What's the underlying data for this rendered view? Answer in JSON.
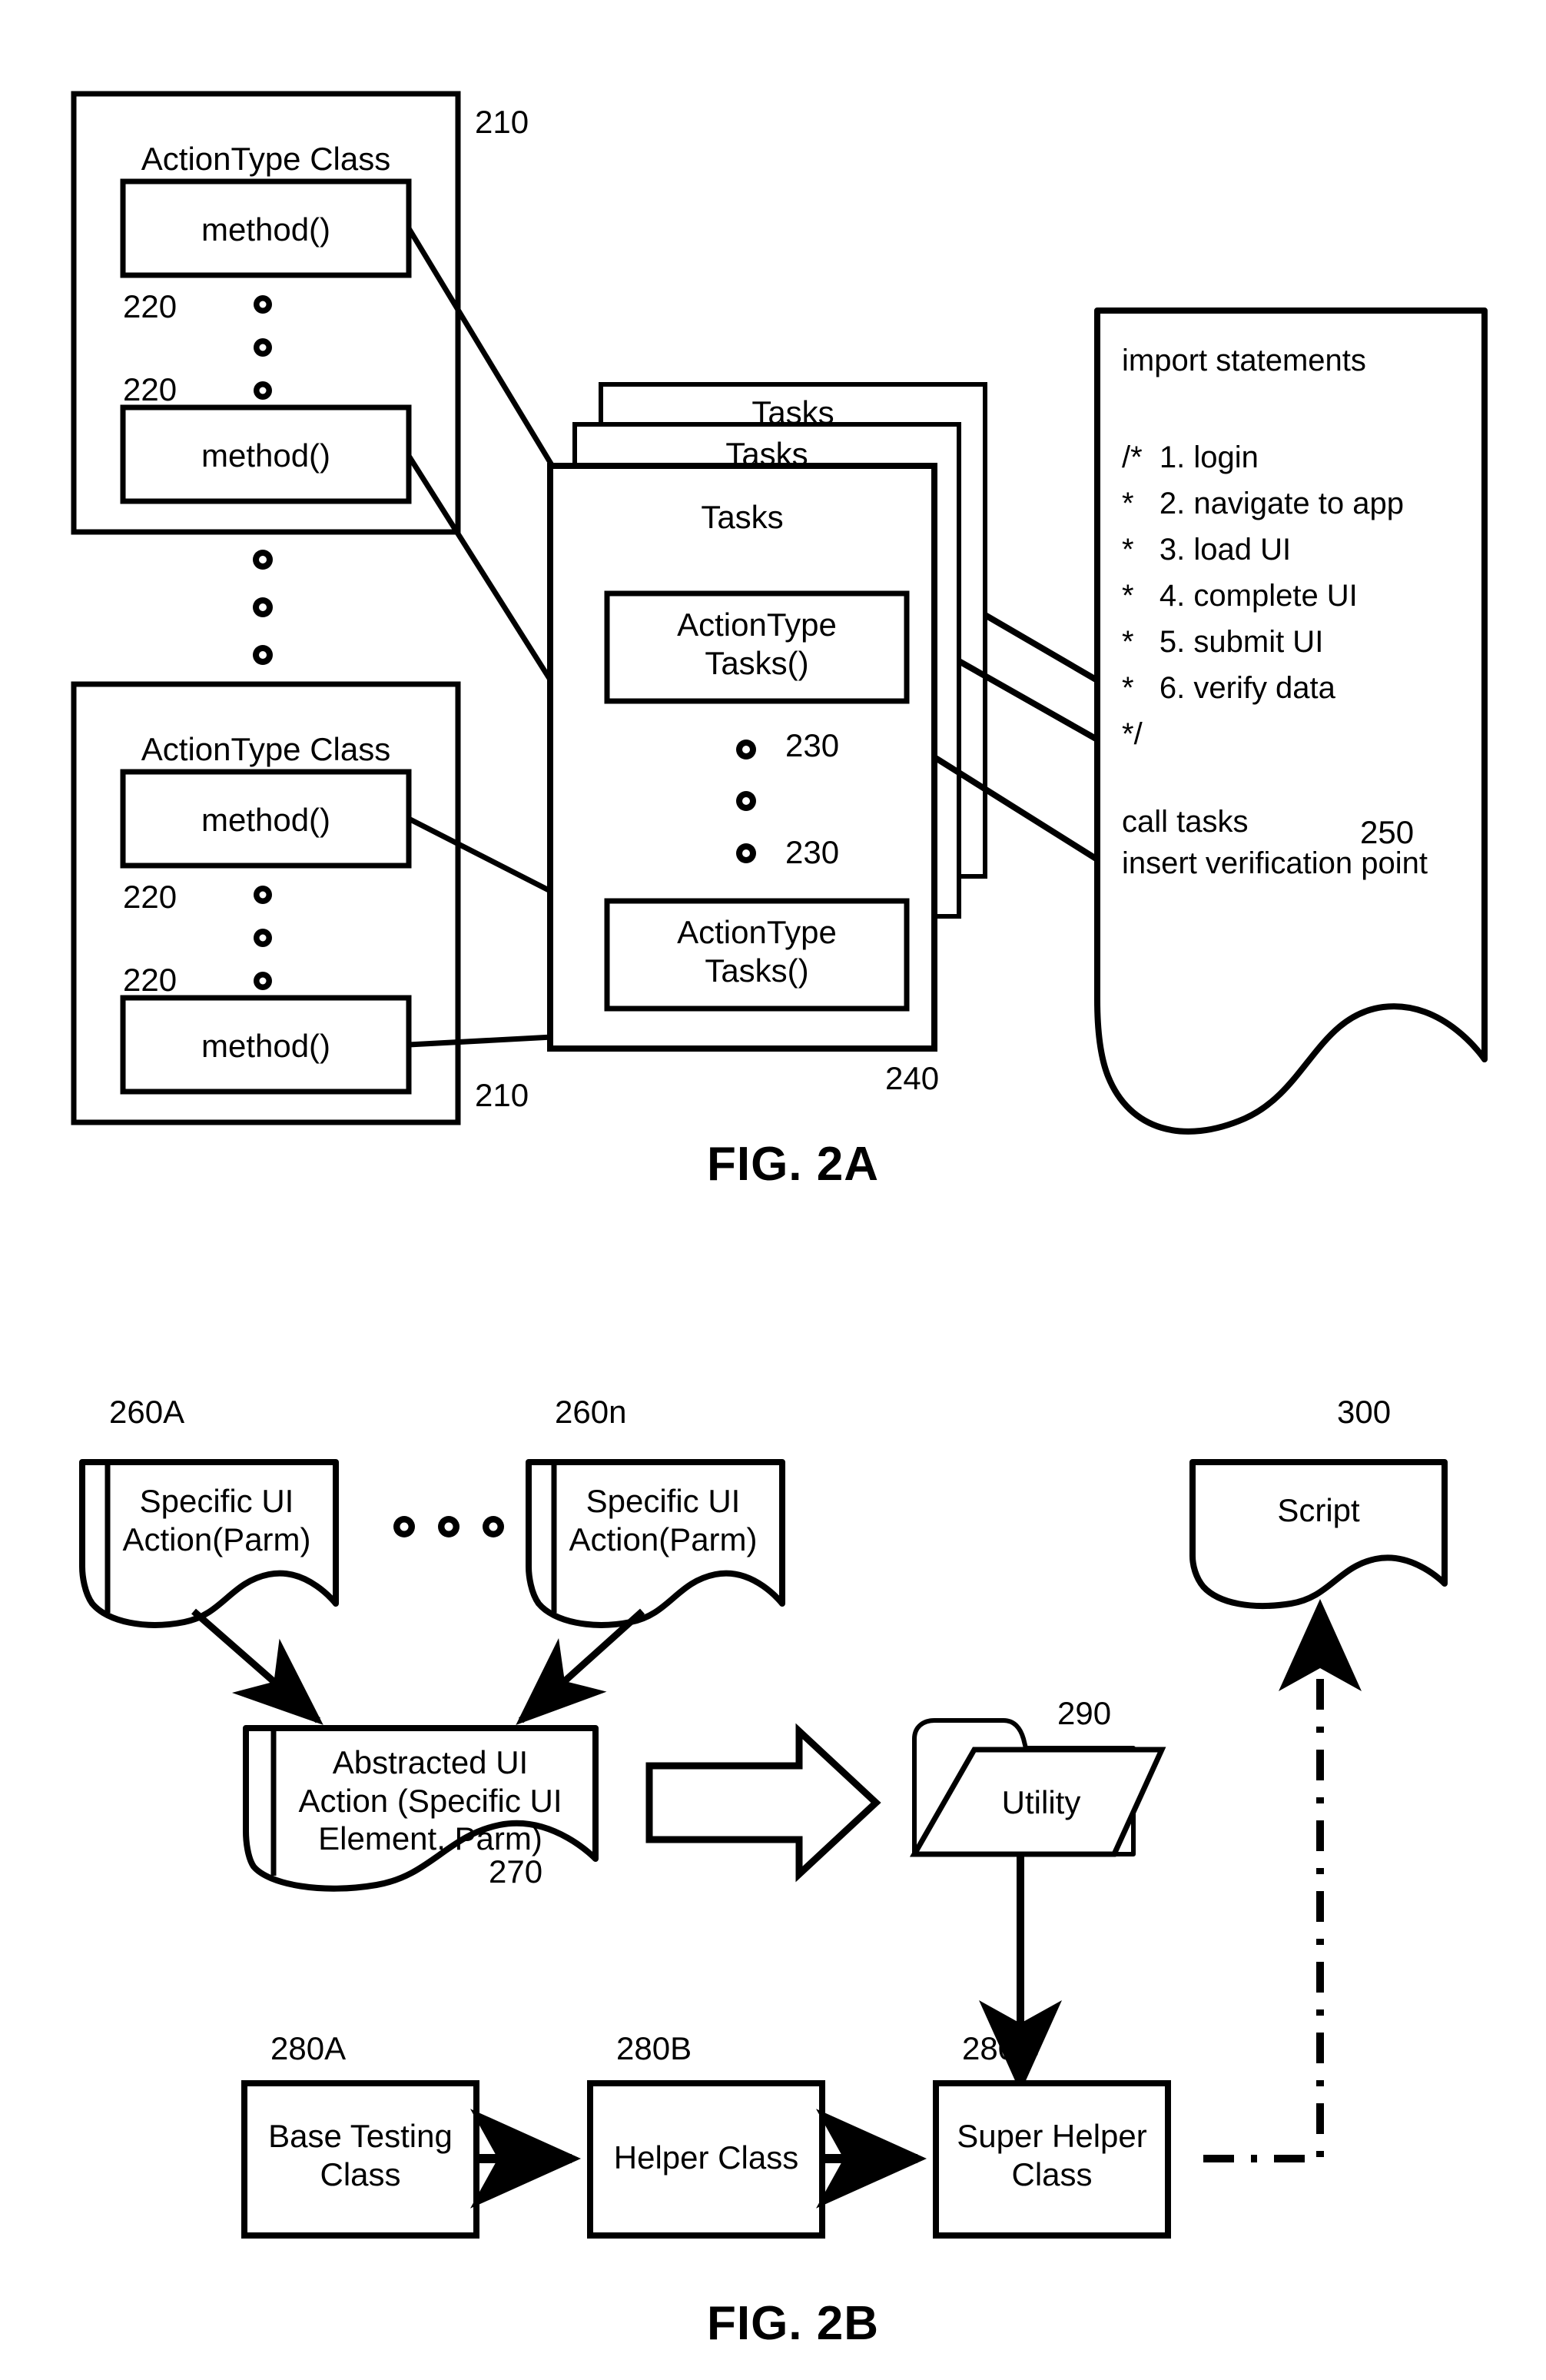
{
  "figures": [
    {
      "id": "fig-2a",
      "caption": "FIG. 2A",
      "action_type_classes": [
        {
          "title": "ActionType Class",
          "ref": "210",
          "methods": [
            "method()",
            "method()"
          ],
          "method_refs": [
            "220",
            "220"
          ]
        },
        {
          "title": "ActionType Class",
          "ref": "210",
          "methods": [
            "method()",
            "method()"
          ],
          "method_refs": [
            "220",
            "220"
          ]
        }
      ],
      "tasks_stack": {
        "title": "Tasks",
        "back_titles": [
          "Tasks",
          "Tasks"
        ],
        "ref": "240",
        "items": [
          "ActionType\nTasks()",
          "ActionType\nTasks()"
        ],
        "item_refs": [
          "230",
          "230"
        ]
      },
      "script_document": {
        "ref": "250",
        "header": "import statements",
        "comment_lines": [
          "/*  1. login",
          "*   2. navigate to app",
          "*   3. load UI",
          "*   4. complete UI",
          "*   5. submit UI",
          "*   6. verify data",
          "*/"
        ],
        "footer_lines": [
          "call tasks",
          "insert verification point"
        ]
      }
    },
    {
      "id": "fig-2b",
      "caption": "FIG. 2B",
      "specific_actions": [
        {
          "ref": "260A",
          "label": "Specific UI\nAction(Parm)"
        },
        {
          "ref": "260n",
          "label": "Specific UI\nAction(Parm)"
        }
      ],
      "abstracted_action": {
        "ref": "270",
        "label": "Abstracted UI\nAction (Specific UI\nElement, Parm)"
      },
      "utility_folder": {
        "ref": "290",
        "label": "Utility"
      },
      "script": {
        "ref": "300",
        "label": "Script"
      },
      "class_chain": [
        {
          "ref": "280A",
          "label": "Base Testing\nClass"
        },
        {
          "ref": "280B",
          "label": "Helper Class"
        },
        {
          "ref": "280C",
          "label": "Super Helper\nClass"
        }
      ]
    }
  ],
  "colors": {
    "ink": "#000000",
    "paper": "#ffffff"
  }
}
